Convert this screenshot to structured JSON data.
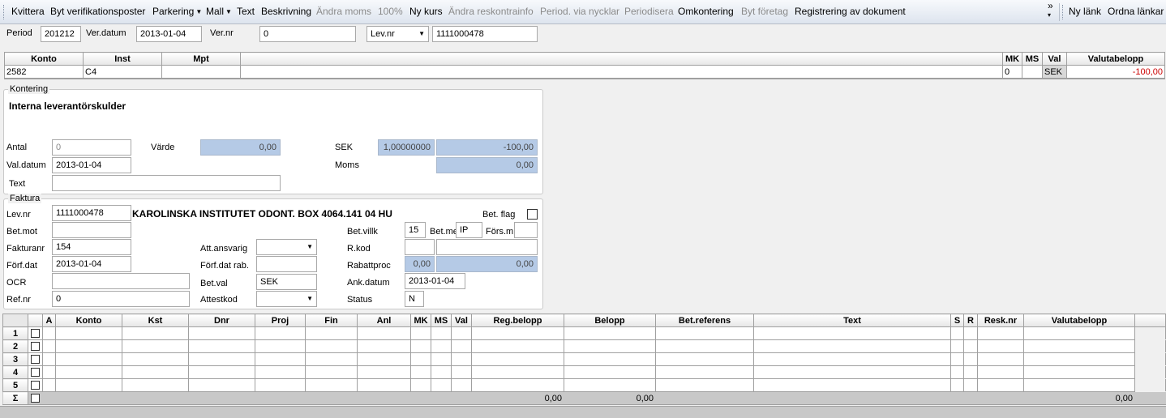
{
  "toolbar": {
    "items": [
      {
        "label": "Kvittera",
        "disabled": false,
        "dropdown": false
      },
      {
        "label": "Byt verifikationsposter",
        "disabled": false,
        "dropdown": false
      },
      {
        "label": "Parkering",
        "disabled": false,
        "dropdown": true
      },
      {
        "label": "Mall",
        "disabled": false,
        "dropdown": true
      },
      {
        "label": "Text",
        "disabled": false,
        "dropdown": false
      },
      {
        "label": "Beskrivning",
        "disabled": false,
        "dropdown": false
      },
      {
        "label": "Ändra moms",
        "disabled": true,
        "dropdown": false
      },
      {
        "label": "100%",
        "disabled": true,
        "dropdown": false
      },
      {
        "label": "Ny kurs",
        "disabled": false,
        "dropdown": false
      },
      {
        "label": "Ändra reskontrainfo",
        "disabled": true,
        "dropdown": false
      },
      {
        "label": "Period. via nycklar",
        "disabled": true,
        "dropdown": false
      },
      {
        "label": "Periodisera",
        "disabled": true,
        "dropdown": false
      },
      {
        "label": "Omkontering",
        "disabled": false,
        "dropdown": false
      },
      {
        "label": "Byt företag",
        "disabled": true,
        "dropdown": false
      },
      {
        "label": "Registrering av dokument",
        "disabled": false,
        "dropdown": false
      }
    ],
    "overflow": "»",
    "links": {
      "new_link": "Ny länk",
      "arrange_links": "Ordna länkar"
    }
  },
  "header": {
    "period_label": "Period",
    "period_value": "201212",
    "verdatum_label": "Ver.datum",
    "verdatum_value": "2013-01-04",
    "vernr_label": "Ver.nr",
    "vernr_value": "0",
    "levnr_select": "Lev.nr",
    "levnr_value": "1111000478"
  },
  "top_grid": {
    "headers": {
      "konto": "Konto",
      "inst": "Inst",
      "mpt": "Mpt",
      "mk": "MK",
      "ms": "MS",
      "val": "Val",
      "valutabelopp": "Valutabelopp"
    },
    "row": {
      "konto": "2582",
      "inst": "C4",
      "mpt": "",
      "mk": "0",
      "ms": "",
      "val": "SEK",
      "valutabelopp": "-100,00"
    }
  },
  "kontering": {
    "title": "Kontering",
    "account_name": "Interna leverantörskulder",
    "antal_label": "Antal",
    "antal_value": "0",
    "varde_label": "Värde",
    "varde_value": "0,00",
    "sek_label": "SEK",
    "sek_rate": "1,00000000",
    "sek_amount": "-100,00",
    "valdatum_label": "Val.datum",
    "valdatum_value": "2013-01-04",
    "moms_label": "Moms",
    "moms_value": "0,00",
    "text_label": "Text",
    "text_value": ""
  },
  "faktura": {
    "title": "Faktura",
    "levnr_label": "Lev.nr",
    "levnr_value": "1111000478",
    "supplier_name": "KAROLINSKA INSTITUTET ODONT. BOX 4064.141 04 HU",
    "betflag_label": "Bet. flag",
    "betmot_label": "Bet.mot",
    "betmot_value": "",
    "betvillk_label": "Bet.villk",
    "betvillk_value": "15",
    "betme_label": "Bet.me",
    "betme_value": "IP",
    "forsm_label": "Förs.m",
    "forsm_value": "",
    "fakturanr_label": "Fakturanr",
    "fakturanr_value": "154",
    "attansvarig_label": "Att.ansvarig",
    "attansvarig_value": "",
    "rkod_label": "R.kod",
    "rkod_value": "",
    "forfdat_label": "Förf.dat",
    "forfdat_value": "2013-01-04",
    "forfdatrab_label": "Förf.dat rab.",
    "forfdatrab_value": "",
    "rabattproc_label": "Rabattproc",
    "rabattproc_value": "0,00",
    "rabatt_amount": "0,00",
    "ocr_label": "OCR",
    "ocr_value": "",
    "betval_label": "Bet.val",
    "betval_value": "SEK",
    "ankdatum_label": "Ank.datum",
    "ankdatum_value": "2013-01-04",
    "refnr_label": "Ref.nr",
    "refnr_value": "0",
    "attestkod_label": "Attestkod",
    "attestkod_value": "",
    "status_label": "Status",
    "status_value": "N"
  },
  "bottom_grid": {
    "headers": [
      "",
      "",
      "A",
      "Konto",
      "Kst",
      "Dnr",
      "Proj",
      "Fin",
      "Anl",
      "MK",
      "MS",
      "Val",
      "Reg.belopp",
      "Belopp",
      "Bet.referens",
      "Text",
      "S",
      "R",
      "Resk.nr",
      "Valutabelopp",
      ""
    ],
    "rows": [
      "1",
      "2",
      "3",
      "4",
      "5"
    ],
    "sum_label": "Σ",
    "sum_regbelopp": "0,00",
    "sum_belopp": "0,00",
    "sum_valutabelopp": "0,00"
  }
}
